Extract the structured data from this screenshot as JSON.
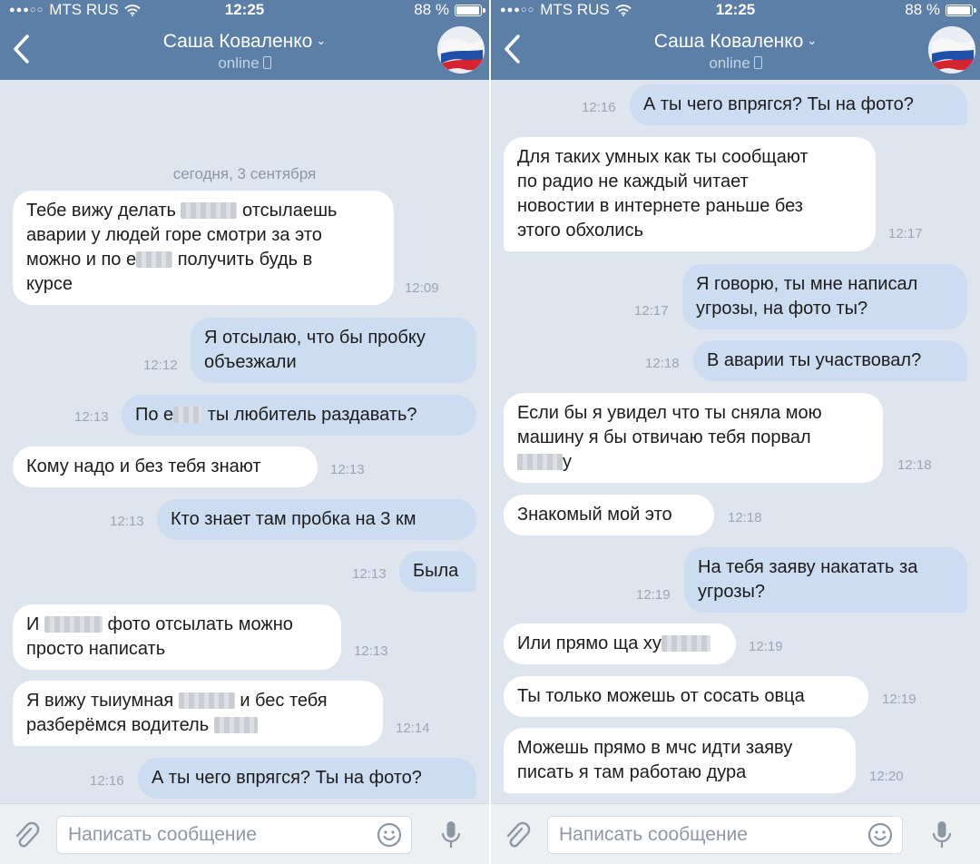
{
  "status_bar": {
    "carrier": "MTS RUS",
    "time": "12:25",
    "battery": "88 %",
    "battery_level": 0.88
  },
  "header": {
    "contact_name": "Саша Коваленко",
    "presence": "online"
  },
  "composer": {
    "placeholder": "Написать сообщение"
  },
  "colors": {
    "header": "#5b7fa6",
    "incoming": "#ffffff",
    "outgoing": "#ccdcf1",
    "background": "#dfe5ee"
  },
  "left_screen": {
    "date_separator": "сегодня, 3 сентября",
    "messages": [
      {
        "dir": "in",
        "parts": [
          "Тебе вижу делать",
          "отсылаешь",
          "аварии у людей горе смотри за это",
          "можно и по е",
          "получить будь в",
          "курсе"
        ],
        "time": "12:09"
      },
      {
        "dir": "out",
        "parts": [
          "Я отсылаю, что бы пробку",
          "объезжали"
        ],
        "time": "12:12"
      },
      {
        "dir": "out",
        "parts": [
          "По е",
          "ты любитель раздавать?"
        ],
        "time": "12:13"
      },
      {
        "dir": "in",
        "parts": [
          "Кому надо и без тебя знают"
        ],
        "time": "12:13"
      },
      {
        "dir": "out",
        "parts": [
          "Кто знает там пробка на 3 км"
        ],
        "time": "12:13"
      },
      {
        "dir": "out",
        "parts": [
          "Была"
        ],
        "time": "12:13"
      },
      {
        "dir": "in",
        "parts": [
          "И",
          "фото отсылать можно",
          "просто написать"
        ],
        "time": "12:13"
      },
      {
        "dir": "in",
        "parts": [
          "Я вижу тыиумная",
          "и бес тебя",
          "разберёмся водитель"
        ],
        "time": "12:14"
      },
      {
        "dir": "out",
        "parts": [
          "А ты чего впрягся? Ты на фото?"
        ],
        "time": "12:16"
      }
    ]
  },
  "right_screen": {
    "messages": [
      {
        "dir": "out",
        "parts": [
          "А ты чего впрягся? Ты на фото?"
        ],
        "time": "12:16"
      },
      {
        "dir": "in",
        "parts": [
          "Для таких умных как ты сообщают",
          "по радио не каждый читает",
          "новостии в интернете раньше без",
          "этого обхолись"
        ],
        "time": "12:17"
      },
      {
        "dir": "out",
        "parts": [
          "Я говорю, ты мне написал",
          "угрозы, на фото ты?"
        ],
        "time": "12:17"
      },
      {
        "dir": "out",
        "parts": [
          "В аварии ты участвовал?"
        ],
        "time": "12:18"
      },
      {
        "dir": "in",
        "parts": [
          "Если бы я увидел что ты сняла мою",
          "машину я бы отвичаю тебя порвал",
          "у"
        ],
        "time": "12:18"
      },
      {
        "dir": "in",
        "parts": [
          "Знакомый мой это"
        ],
        "time": "12:18"
      },
      {
        "dir": "out",
        "parts": [
          "На тебя заяву накатать за",
          "угрозы?"
        ],
        "time": "12:19"
      },
      {
        "dir": "in",
        "parts": [
          "Или прямо ща ху"
        ],
        "time": "12:19"
      },
      {
        "dir": "in",
        "parts": [
          "Ты только можешь от сосать овца"
        ],
        "time": "12:19"
      },
      {
        "dir": "in",
        "parts": [
          "Можешь прямо в мчс идти заяву",
          "писать я там работаю дура"
        ],
        "time": "12:20"
      }
    ]
  }
}
